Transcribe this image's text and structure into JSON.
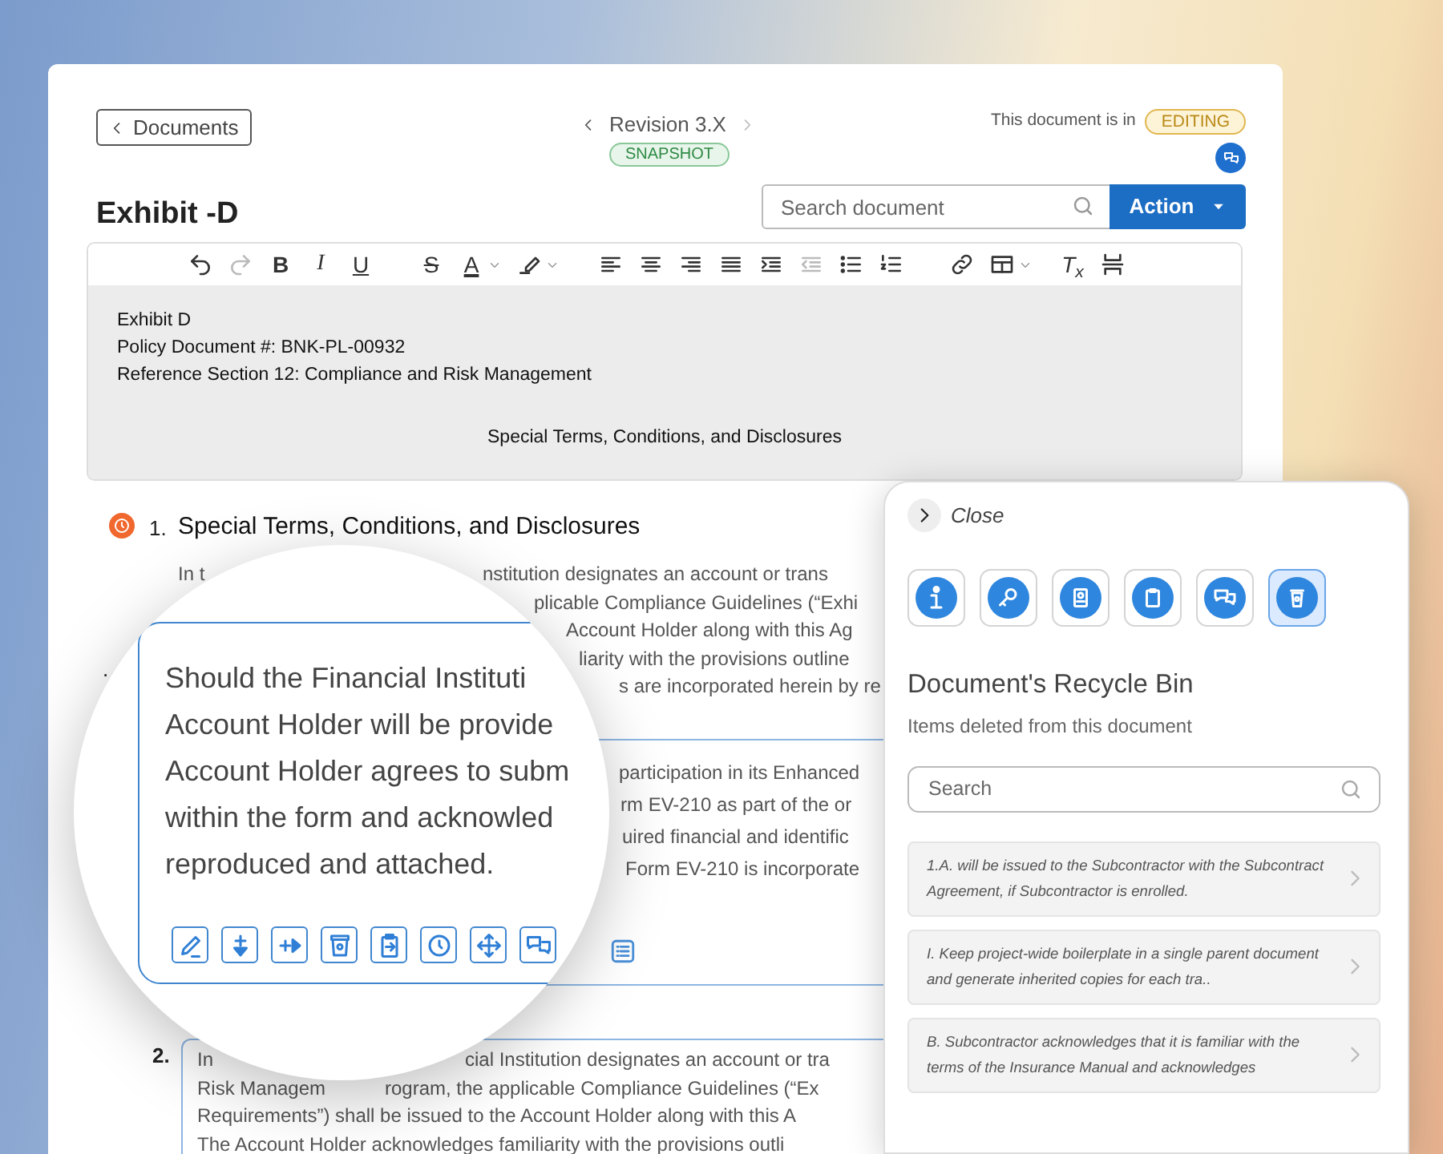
{
  "header": {
    "back_button": "Documents",
    "revision": "Revision 3.X",
    "revision_badge": "SNAPSHOT",
    "status_label": "This document is in",
    "status_badge": "EDITING"
  },
  "title": "Exhibit -D",
  "search": {
    "placeholder": "Search document"
  },
  "action_button": "Action",
  "toolbar": [
    {
      "disabled": false
    },
    {
      "disabled": true
    },
    {
      "glyph": "B",
      "disabled": false
    },
    {
      "glyph": "I",
      "disabled": false
    },
    {
      "glyph": "U",
      "disabled": false
    },
    {
      "glyph": "S",
      "disabled": false
    },
    {
      "glyph": "A",
      "disabled": false
    },
    {
      "disabled": false
    },
    {
      "disabled": false
    },
    {
      "disabled": false
    },
    {
      "disabled": false
    },
    {
      "disabled": false
    },
    {
      "disabled": false
    },
    {
      "disabled": true
    },
    {
      "disabled": false
    },
    {
      "disabled": false
    },
    {
      "disabled": false
    },
    {
      "disabled": false
    },
    {
      "glyph": "T$_{x}$",
      "disabled": false
    },
    {
      "disabled": false
    }
  ],
  "editor": {
    "lines": [
      "Exhibit D",
      "Policy Document #: BNK-PL-00932",
      "Reference Section 12: Compliance and Risk Management"
    ],
    "centered_heading": "Special Terms, Conditions, and Disclosures"
  },
  "section_1": {
    "number": "1.",
    "heading": "Special Terms, Conditions, and Disclosures",
    "lines": [
      {
        "left": "In t",
        "right": "nstitution designates an account or trans"
      },
      {
        "right": "plicable Compliance Guidelines (“Exhi"
      },
      {
        "right": "Account Holder along with this Ag"
      },
      {
        "right": "liarity with the provisions outline"
      },
      {
        "right": "s are incorporated herein by re"
      }
    ]
  },
  "item_box": {
    "bullet": ".",
    "lines": [
      "participation in its Enhanced",
      "rm EV-210 as part of the or",
      "uired financial and identific",
      "Form EV-210 is incorporate"
    ]
  },
  "magnifier": {
    "lines": [
      "Should the Financial Instituti",
      "Account Holder will be provide",
      "Account Holder agrees to subm",
      "within the form and acknowled",
      "reproduced and attached."
    ]
  },
  "section_2": {
    "number": "2.",
    "lines": [
      {
        "left": "In",
        "right": "cial Institution designates an account or tra"
      },
      {
        "left": "Risk Managem",
        "right": "rogram, the applicable Compliance Guidelines (“Ex"
      },
      {
        "left": "Requirements”) shall be issued to the Account Holder along with this A"
      },
      {
        "left": "The Account Holder acknowledges familiarity with the provisions outli"
      }
    ]
  },
  "recycle_panel": {
    "close": "Close",
    "tabs": [
      {
        "selected": false
      },
      {
        "selected": false
      },
      {
        "selected": false
      },
      {
        "selected": false
      },
      {
        "selected": false
      },
      {
        "selected": true
      }
    ],
    "title": "Document's Recycle Bin",
    "subtitle": "Items deleted from this document",
    "search": {
      "placeholder": "Search"
    },
    "items": [
      {
        "text": "1.A. will be issued to the Subcontractor with the Subcontract Agreement, if Subcontractor is enrolled."
      },
      {
        "text": "I. Keep project-wide boilerplate in a single parent document and generate inherited copies for each tra.."
      },
      {
        "text": "B. Subcontractor acknowledges that it is familiar with the terms of the Insurance Manual and acknowledges"
      }
    ]
  }
}
